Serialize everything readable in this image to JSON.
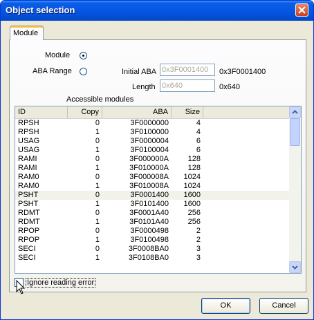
{
  "window": {
    "title": "Object selection"
  },
  "tabs": [
    {
      "label": "Module"
    }
  ],
  "form": {
    "module_label": "Module",
    "aba_range_label": "ABA Range",
    "initial_aba_label": "Initial ABA",
    "initial_aba_value": "0x3F0001400",
    "initial_aba_readout": "0x3F0001400",
    "length_label": "Length",
    "length_value": "0x640",
    "length_readout": "0x640",
    "selected_option": "Module"
  },
  "modules": {
    "title": "Accessible modules",
    "columns": [
      "ID",
      "Copy",
      "ABA",
      "Size"
    ],
    "rows": [
      [
        "RPSH",
        "0",
        "3F0000000",
        "4"
      ],
      [
        "RPSH",
        "1",
        "3F0100000",
        "4"
      ],
      [
        "USAG",
        "0",
        "3F0000004",
        "6"
      ],
      [
        "USAG",
        "1",
        "3F0100004",
        "6"
      ],
      [
        "RAMI",
        "0",
        "3F000000A",
        "128"
      ],
      [
        "RAMI",
        "1",
        "3F010000A",
        "128"
      ],
      [
        "RAM0",
        "0",
        "3F000008A",
        "1024"
      ],
      [
        "RAM0",
        "1",
        "3F010008A",
        "1024"
      ],
      [
        "PSHT",
        "0",
        "3F0001400",
        "1600"
      ],
      [
        "PSHT",
        "1",
        "3F0101400",
        "1600"
      ],
      [
        "RDMT",
        "0",
        "3F0001A40",
        "256"
      ],
      [
        "RDMT",
        "1",
        "3F0101A40",
        "256"
      ],
      [
        "RPOP",
        "0",
        "3F0000498",
        "2"
      ],
      [
        "RPOP",
        "1",
        "3F0100498",
        "2"
      ],
      [
        "SECI",
        "0",
        "3F0008BA0",
        "3"
      ],
      [
        "SECI",
        "1",
        "3F0108BA0",
        "3"
      ]
    ],
    "selected_row": 8
  },
  "options": {
    "ignore_label": "Ignore reading error",
    "ignore_checked": false
  },
  "buttons": {
    "ok": "OK",
    "cancel": "Cancel"
  }
}
